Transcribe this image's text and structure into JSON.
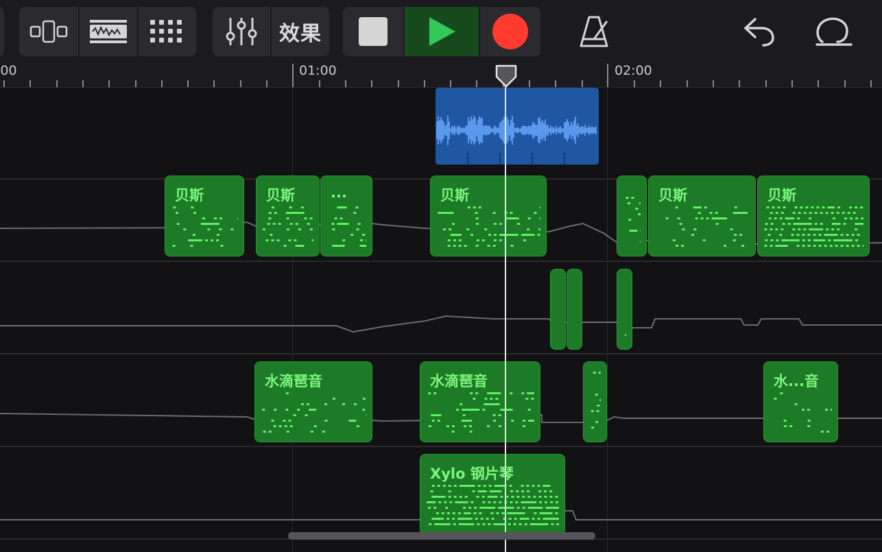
{
  "toolbar": {
    "effects_label": "效果",
    "colors": {
      "play_bg": "#174a1c",
      "play_icon": "#34c759",
      "record": "#ff3b30",
      "stop": "#d6d6d6"
    }
  },
  "ruler": {
    "labels": [
      ":00",
      "01:00",
      "02:00"
    ]
  },
  "tracks": {
    "region_labels": {
      "r_bass_1": "贝斯",
      "r_bass_2": "贝斯",
      "r_bass_3": "...",
      "r_bass_4": "贝斯",
      "r_bass_6": "贝斯",
      "r_bass_7": "贝斯",
      "r_pipa_1": "水滴琶音",
      "r_pipa_2": "水滴琶音",
      "r_pipa_4": "水...音",
      "r_xylo_1": "Xylo 钢片琴"
    },
    "colors": {
      "midi_region": "#1d7a26",
      "midi_notes": "#5ff063",
      "audio_region": "#1f57a3",
      "audio_wave": "#6aa8ff"
    }
  }
}
